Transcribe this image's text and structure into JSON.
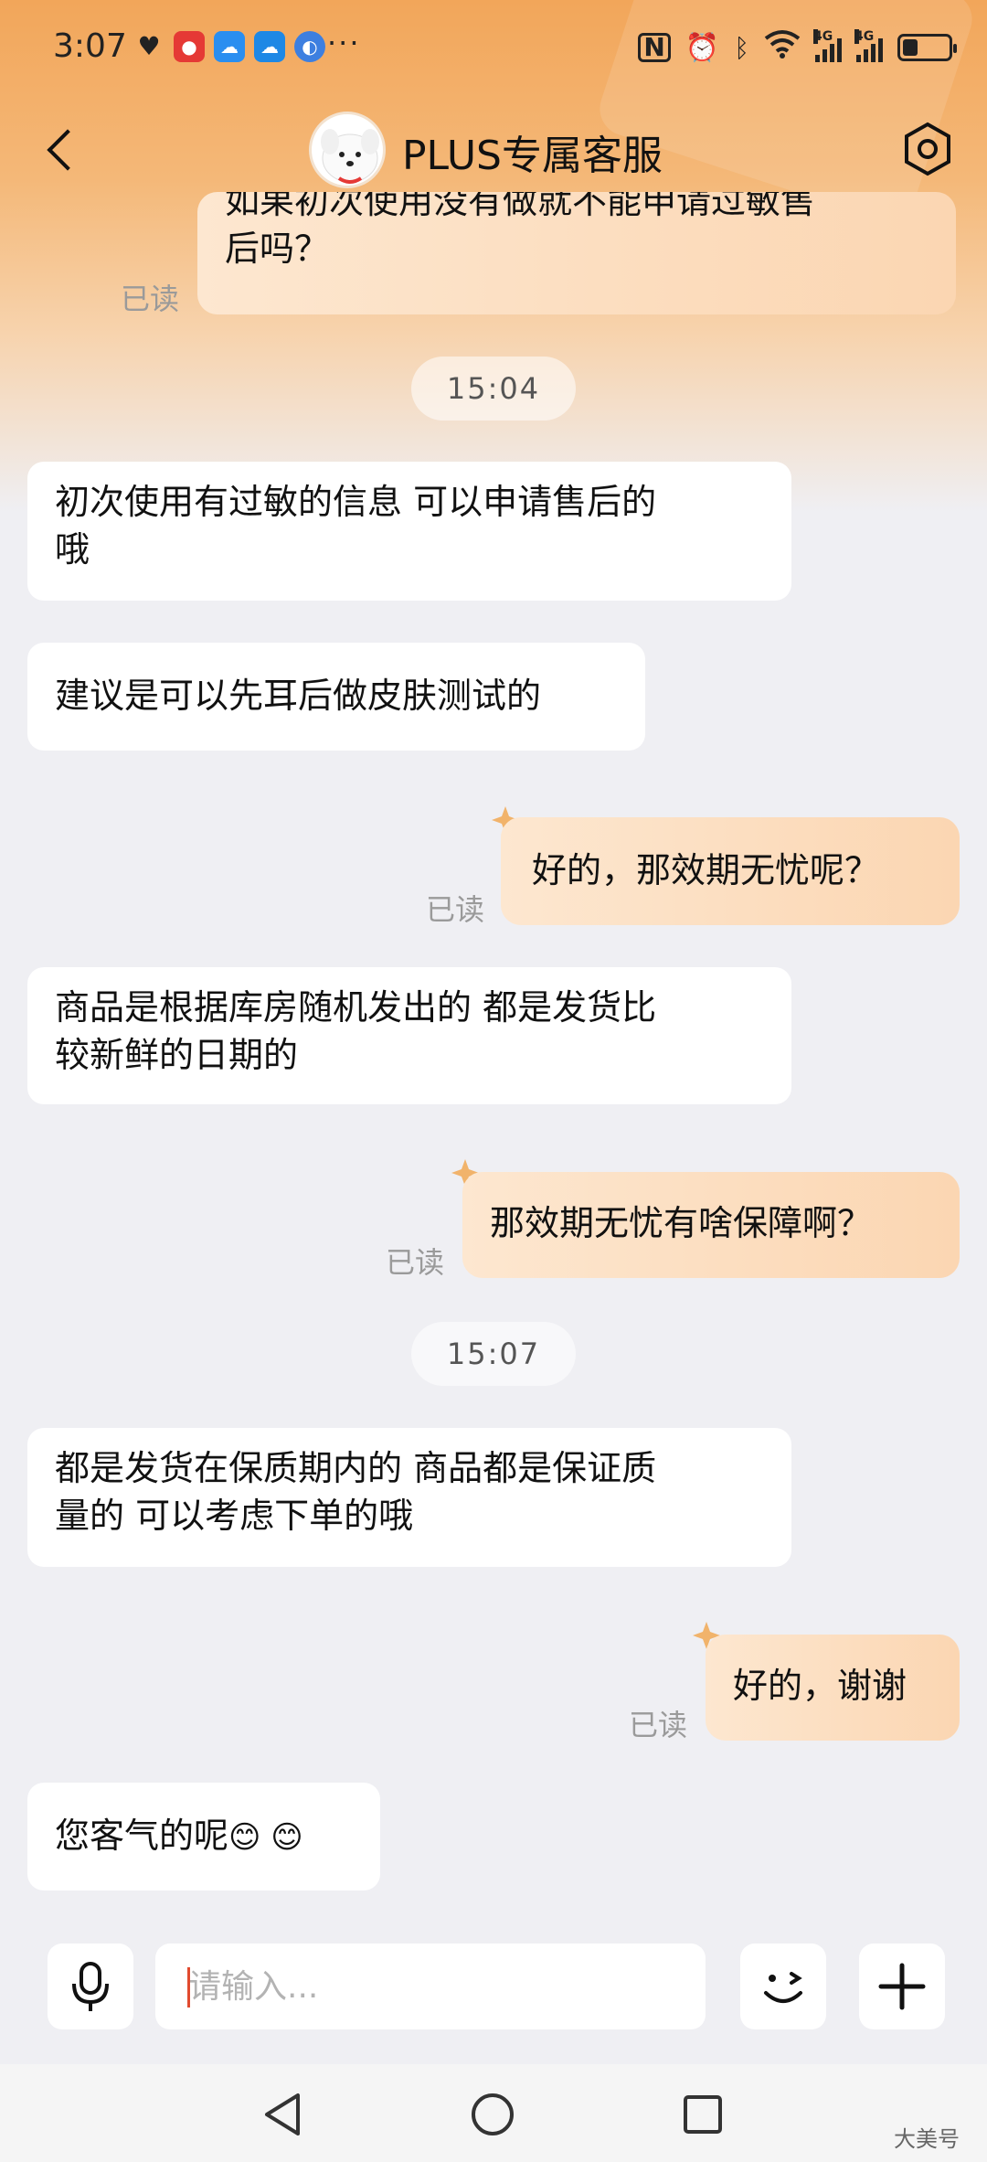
{
  "status_bar": {
    "time": "3:07",
    "more": "···",
    "network_label": "4G"
  },
  "header": {
    "title": "PLUS专属客服"
  },
  "messages": [
    {
      "side": "out",
      "text_line1": "如果初次使用没有做就不能申请过敏售",
      "text_line2": "后吗？",
      "read": "已读"
    },
    {
      "side": "time",
      "text": "15:04"
    },
    {
      "side": "in",
      "text_line1": "初次使用有过敏的信息  可以申请售后的",
      "text_line2": "哦"
    },
    {
      "side": "in",
      "text": "建议是可以先耳后做皮肤测试的"
    },
    {
      "side": "out",
      "text": "好的，那效期无忧呢？",
      "read": "已读"
    },
    {
      "side": "in",
      "text_line1": "商品是根据库房随机发出的  都是发货比",
      "text_line2": "较新鲜的日期的"
    },
    {
      "side": "out",
      "text": "那效期无忧有啥保障啊？",
      "read": "已读"
    },
    {
      "side": "time",
      "text": "15:07"
    },
    {
      "side": "in",
      "text_line1": "都是发货在保质期内的  商品都是保证质",
      "text_line2": "量的  可以考虑下单的哦"
    },
    {
      "side": "out",
      "text": "好的，谢谢",
      "read": "已读"
    },
    {
      "side": "in",
      "text": "您客气的呢",
      "emoji": "😊 😊"
    }
  ],
  "input": {
    "placeholder": "请输入..."
  },
  "icons": {
    "back": "back-arrow-icon",
    "settings": "settings-hexagon-icon",
    "mic": "microphone-icon",
    "emoji": "emoji-wink-icon",
    "plus": "plus-icon",
    "nav_back": "triangle-back-icon",
    "nav_home": "circle-home-icon",
    "nav_recent": "square-recent-icon"
  },
  "colors": {
    "accent_orange": "#f2a65a",
    "bubble_out": "#fbd6b2",
    "bubble_in": "#ffffff",
    "background": "#efeff3",
    "read_text": "#9a9a9a"
  },
  "watermark": "大美号"
}
